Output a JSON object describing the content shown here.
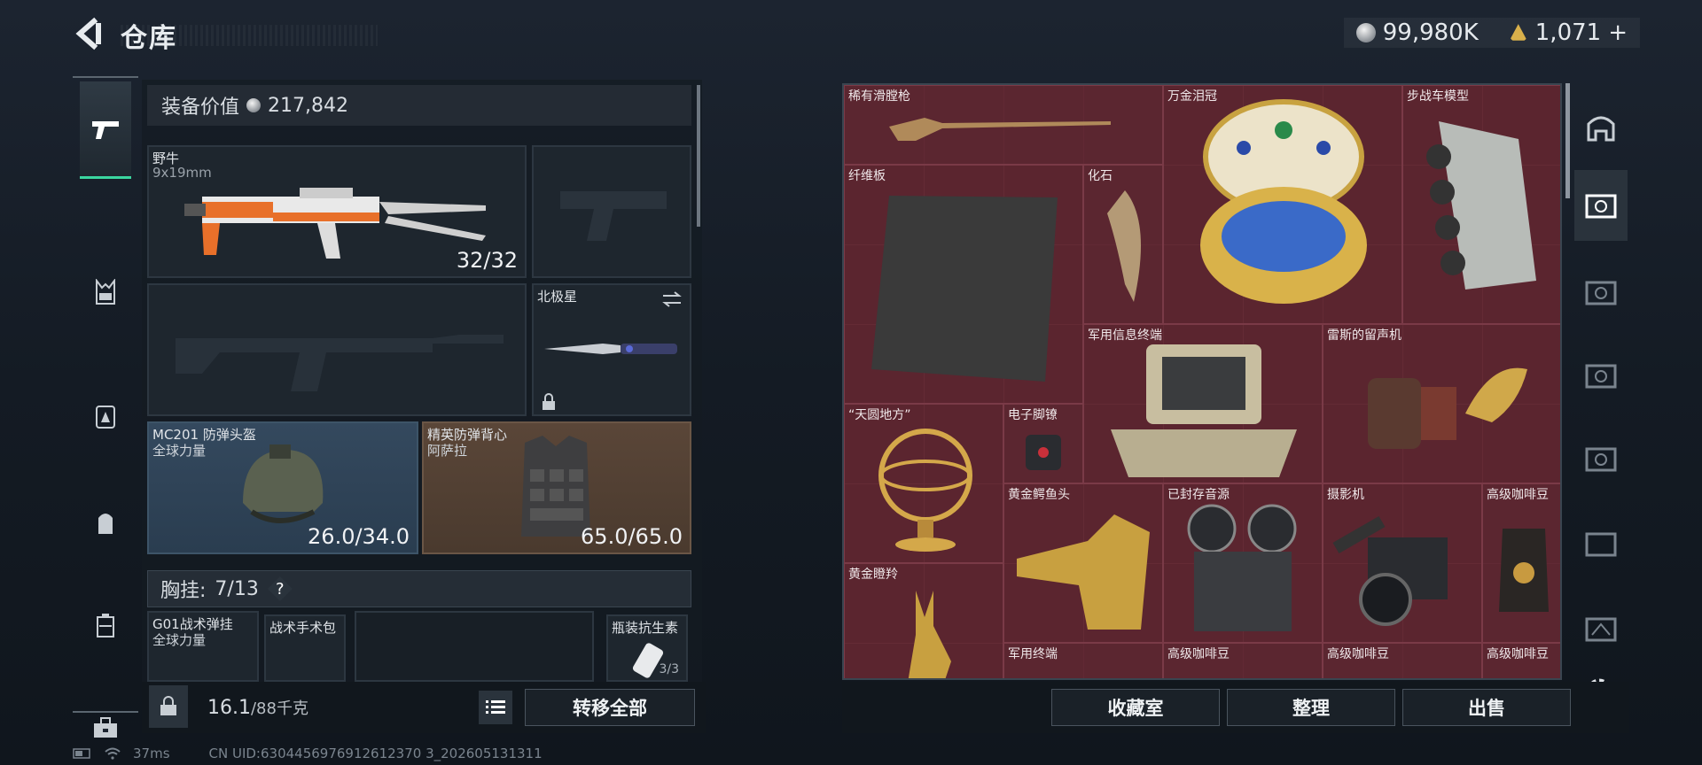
{
  "header": {
    "title": "仓库",
    "currency_silver": "99,980K",
    "currency_gold": "1,071",
    "currency_add": "+"
  },
  "equip": {
    "value_label": "装备价值",
    "value": "217,842",
    "primary": {
      "name": "野牛",
      "caliber": "9x19mm",
      "ammo": "32/32"
    },
    "melee": {
      "name": "北极星"
    },
    "helmet": {
      "name": "MC201 防弹头盔",
      "maker": "全球力量",
      "durability": "26.0/34.0"
    },
    "vest": {
      "name": "精英防弹背心",
      "maker": "阿萨拉",
      "durability": "65.0/65.0"
    },
    "chest_label": "胸挂:",
    "chest_count": "7/13",
    "help": "?",
    "chest_items": [
      {
        "name": "G01战术弹挂",
        "maker": "全球力量"
      },
      {
        "name": "战术手术包"
      },
      {
        "name": "瓶装抗生素",
        "count": "3/3"
      }
    ]
  },
  "bottom_left": {
    "weight": "16.1",
    "weight_max": "/88千克",
    "transfer_all": "转移全部"
  },
  "storage": {
    "items": [
      "稀有滑膛枪",
      "万金泪冠",
      "步战车模型",
      "纤维板",
      "化石",
      "军用信息终端",
      "雷斯的留声机",
      "“天圆地方”",
      "电子脚镣",
      "黄金鳄鱼头",
      "已封存音源",
      "摄影机",
      "高级咖啡豆",
      "黄金瞪羚",
      "军用终端",
      "高级咖啡豆",
      "高级咖啡豆",
      "高级咖啡豆"
    ]
  },
  "bottom_right": {
    "collection": "收藏室",
    "sort": "整理",
    "sell": "出售"
  },
  "status": {
    "ping": "37ms",
    "uid": "CN UID:6304456976912612370 3_202605131311"
  },
  "colors": {
    "accent": "#3bd7a0",
    "storage_bg": "#5a2630"
  }
}
